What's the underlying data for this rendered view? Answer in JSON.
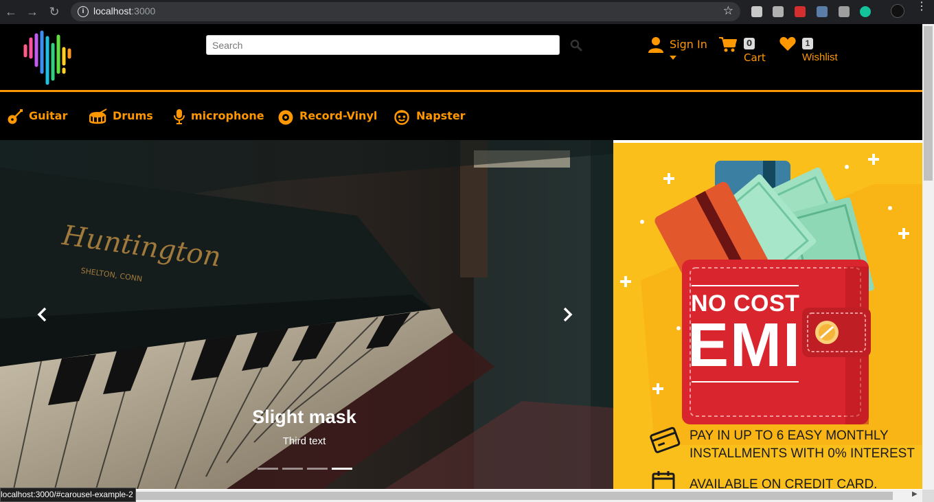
{
  "browser": {
    "url_host": "localhost",
    "url_port": ":3000",
    "status_url": "localhost:3000/#carousel-example-2"
  },
  "header": {
    "search_placeholder": "Search",
    "signin_label": "Sign In",
    "cart_count": "0",
    "cart_label": "Cart",
    "wishlist_count": "1",
    "wishlist_label": "Wishlist"
  },
  "categories": [
    {
      "label": "Guitar",
      "icon": "guitar-icon"
    },
    {
      "label": "Drums",
      "icon": "drum-icon"
    },
    {
      "label": "microphone",
      "icon": "microphone-icon"
    },
    {
      "label": "Record-Vinyl",
      "icon": "record-vinyl-icon"
    },
    {
      "label": "Napster",
      "icon": "napster-icon"
    }
  ],
  "carousel": {
    "caption_title": "Slight mask",
    "caption_text": "Third text",
    "slide_count": 4,
    "active_slide": 4
  },
  "banner": {
    "headline": "NO COST",
    "big": "EMI",
    "line1": "PAY IN UP TO 6 EASY MONTHLY",
    "line2": "INSTALLMENTS WITH 0% INTEREST",
    "line3": "AVAILABLE ON CREDIT CARD."
  },
  "colors": {
    "accent": "#ff9800",
    "header_bg": "#000000",
    "banner_bg": "#fbbf1c",
    "wallet_red": "#d9262e"
  }
}
